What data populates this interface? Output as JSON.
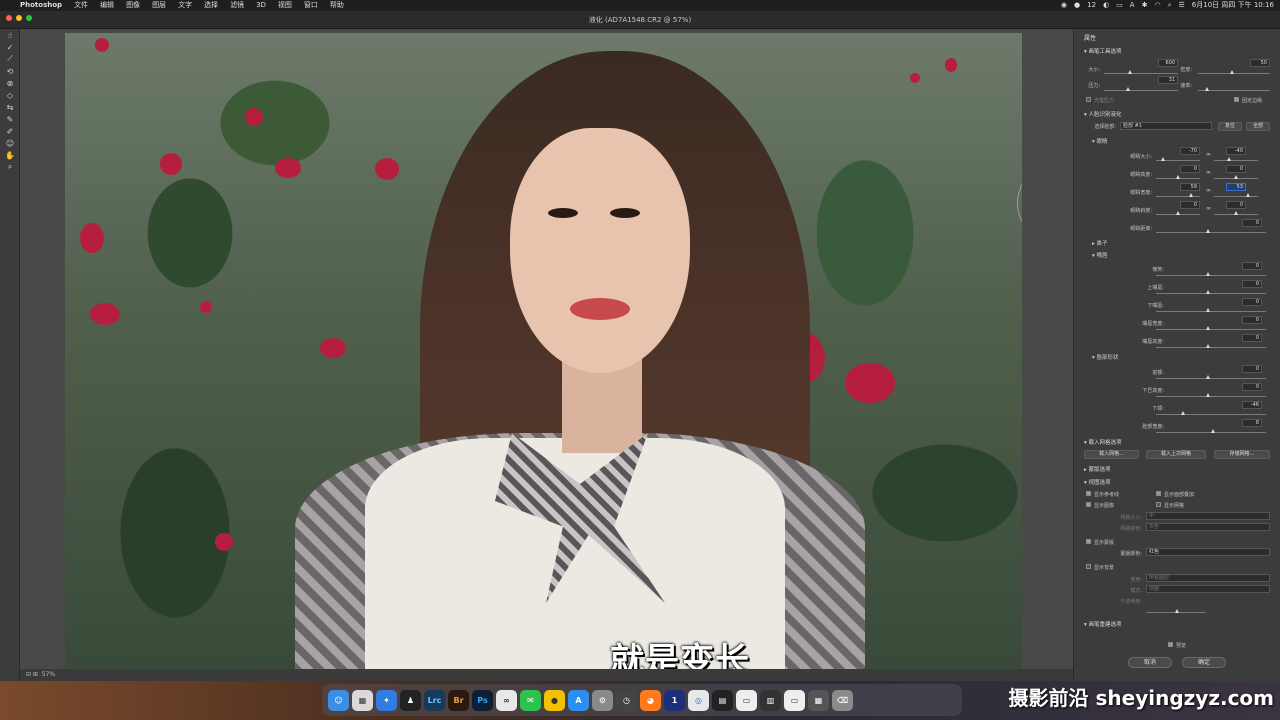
{
  "menubar": {
    "app": "Photoshop",
    "items": [
      "文件",
      "编辑",
      "图像",
      "图层",
      "文字",
      "选择",
      "滤镜",
      "3D",
      "视图",
      "窗口",
      "帮助"
    ],
    "battery_badge": "12",
    "datetime": "6月10日 周四 下午 10:16"
  },
  "window": {
    "title": "液化 (AD7A1548.CR2 @ 57%)"
  },
  "statusbar": {
    "zoom": "57%"
  },
  "subtitle": "就是变长",
  "watermark": "摄影前沿 sheyingzyz.com",
  "panel": {
    "title": "属性",
    "brush": {
      "heading": "画笔工具选项",
      "size_label": "大小:",
      "size": "600",
      "density_label": "密度:",
      "density": "50",
      "pressure_label": "压力:",
      "pressure": "31",
      "rate_label": "速率:",
      "stylus_label": "光笔压力",
      "pin_edges_label": "固定边缘"
    },
    "face": {
      "heading": "人脸识别液化",
      "select_face_label": "选择脸部:",
      "select_face_value": "脸部 #1",
      "reset": "复位",
      "all": "全部",
      "eyes_heading": "眼睛",
      "eye_size_label": "眼睛大小:",
      "eye_size_l": "-70",
      "eye_size_r": "-40",
      "eye_height_label": "眼睛高度:",
      "eye_height_l": "0",
      "eye_height_r": "0",
      "eye_width_label": "眼睛宽度:",
      "eye_width_l": "59",
      "eye_width_r": "53",
      "eye_tilt_label": "眼睛斜度:",
      "eye_tilt_l": "0",
      "eye_tilt_r": "0",
      "eye_distance_label": "眼睛距离:",
      "eye_distance": "0",
      "nose_heading": "鼻子",
      "mouth_heading": "嘴唇",
      "smile_label": "微笑:",
      "smile": "0",
      "upper_lip_label": "上嘴唇:",
      "upper_lip": "0",
      "lower_lip_label": "下嘴唇:",
      "lower_lip": "0",
      "mouth_width_label": "嘴唇宽度:",
      "mouth_width": "0",
      "mouth_height_label": "嘴唇高度:",
      "mouth_height": "0",
      "face_shape_heading": "脸部形状",
      "forehead_label": "前额:",
      "forehead": "0",
      "chin_height_label": "下巴高度:",
      "chin_height": "0",
      "jawline_label": "下颌:",
      "jawline": "-46",
      "face_width_label": "脸部宽度:",
      "face_width": "8"
    },
    "load_mesh": {
      "heading": "载入网格选项",
      "load": "载入网格...",
      "load_last": "载入上次网格",
      "save": "存储网格..."
    },
    "mask_heading": "蒙版选项",
    "view": {
      "heading": "视图选项",
      "show_guides": "显示参考线",
      "show_face_overlay": "显示面部叠加",
      "show_image": "显示图像",
      "show_mesh": "显示网格",
      "mesh_size_label": "网格大小:",
      "mesh_size": "中",
      "mesh_color_label": "网格颜色:",
      "mesh_color": "灰色",
      "show_mask": "显示蒙版",
      "mask_color_label": "蒙版颜色:",
      "mask_color": "红色",
      "show_backdrop": "显示背景",
      "use_label": "使用:",
      "use": "所有图层",
      "mode_label": "模式:",
      "mode": "前面",
      "opacity_label": "不透明度:"
    },
    "brush_reconstruct_heading": "画笔重建选项",
    "preview": "预览",
    "cancel": "取消",
    "ok": "确定"
  },
  "colors": {
    "accent_blue": "#2f6fd6",
    "traffic_red": "#ff5f57",
    "traffic_yellow": "#febc2e",
    "traffic_green": "#28c840"
  }
}
